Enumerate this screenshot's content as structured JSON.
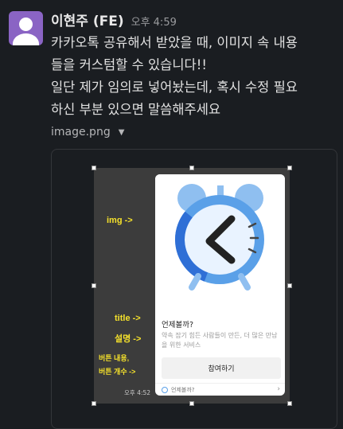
{
  "user": {
    "name": "이현주 (FE)",
    "time": "오후 4:59"
  },
  "message": {
    "lines": [
      "카카오톡 공유해서 받았을 때, 이미지 속 내용",
      "들을 커스텀할 수 있습니다!!",
      " 일단 제가 임의로 넣어놨는데, 혹시 수정 필요",
      "하신 부분 있으면 말씀해주세요"
    ]
  },
  "attachment": {
    "filename": "image.png"
  },
  "screenshot": {
    "annotations": {
      "img": "img ->",
      "title": "title ->",
      "desc": "설명 ->",
      "button1": "버튼 내용,",
      "button2": "버튼 개수 ->"
    },
    "card": {
      "title": "언제볼까?",
      "description": "약속 잡기 힘든 사람들이 만든, 더 많은 만남을 위한 서비스",
      "button": "참여하기",
      "footer": "언제볼까?"
    },
    "time": "오후 4:52"
  },
  "colors": {
    "avatar": "#8a64c4",
    "annotation": "#f5e12b",
    "clock_blue": "#5aa0e8"
  }
}
